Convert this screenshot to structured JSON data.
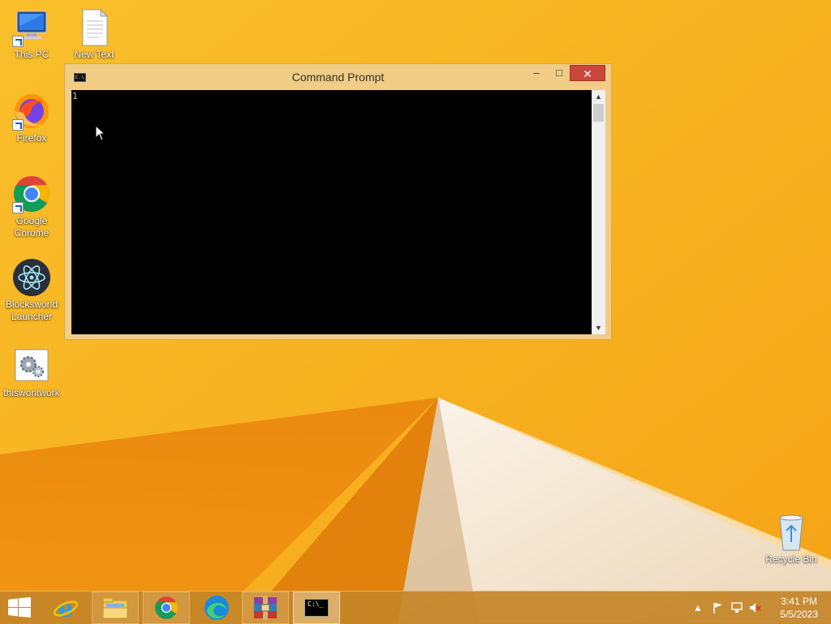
{
  "desktop": {
    "icons": [
      {
        "label": "This PC"
      },
      {
        "label": "New Text Document"
      },
      {
        "label": "Firefox"
      },
      {
        "label": "Google Chrome"
      },
      {
        "label": "Blocksworld Launcher"
      },
      {
        "label": "thiswontwork"
      },
      {
        "label": "Recycle Bin"
      }
    ]
  },
  "cmd_window": {
    "title": "Command Prompt",
    "icon_text": "C:\\",
    "console_output": "1",
    "minimize": "–",
    "maximize": "□",
    "close": "✕"
  },
  "taskbar": {
    "items": [
      {
        "icon": "windows-start-icon"
      },
      {
        "icon": "internet-explorer-icon"
      },
      {
        "icon": "file-explorer-icon"
      },
      {
        "icon": "chrome-icon"
      },
      {
        "icon": "edge-icon"
      },
      {
        "icon": "winrar-icon"
      },
      {
        "icon": "cmd-icon"
      }
    ],
    "cmd_icon_text": "C:\\_",
    "tray": {
      "time": "3:41 PM",
      "date": "5/5/2023"
    }
  },
  "colors": {
    "wallpaper": "#f4a818",
    "close_button": "#c9473b",
    "taskbar": "#c48528"
  }
}
